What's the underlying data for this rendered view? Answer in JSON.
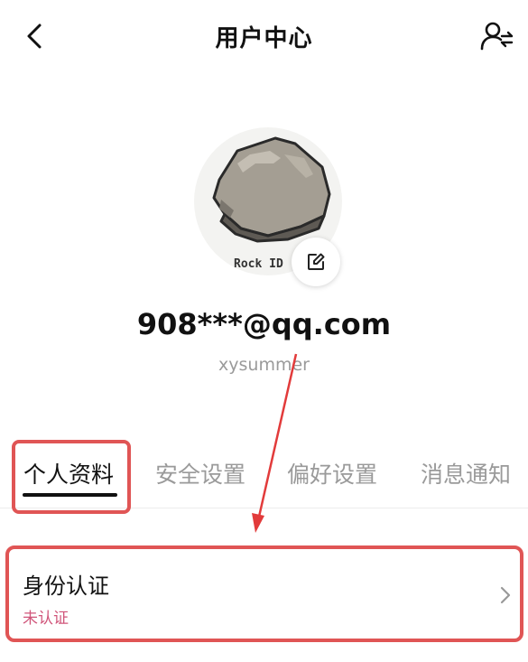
{
  "header": {
    "title": "用户中心",
    "back_icon": "chevron-left-icon",
    "switch_icon": "user-switch-icon"
  },
  "profile": {
    "avatar_caption": "Rock ID",
    "email": "908***@qq.com",
    "username": "xysummer",
    "edit_icon": "edit-icon"
  },
  "tabs": [
    {
      "label": "个人资料",
      "active": true
    },
    {
      "label": "安全设置",
      "active": false
    },
    {
      "label": "偏好设置",
      "active": false
    },
    {
      "label": "消息通知",
      "active": false
    }
  ],
  "verification": {
    "title": "身份认证",
    "status": "未认证",
    "chevron_icon": "chevron-right-icon"
  },
  "colors": {
    "highlight": "#e05555",
    "status": "#d0557a",
    "arrow": "#e23b3b"
  }
}
